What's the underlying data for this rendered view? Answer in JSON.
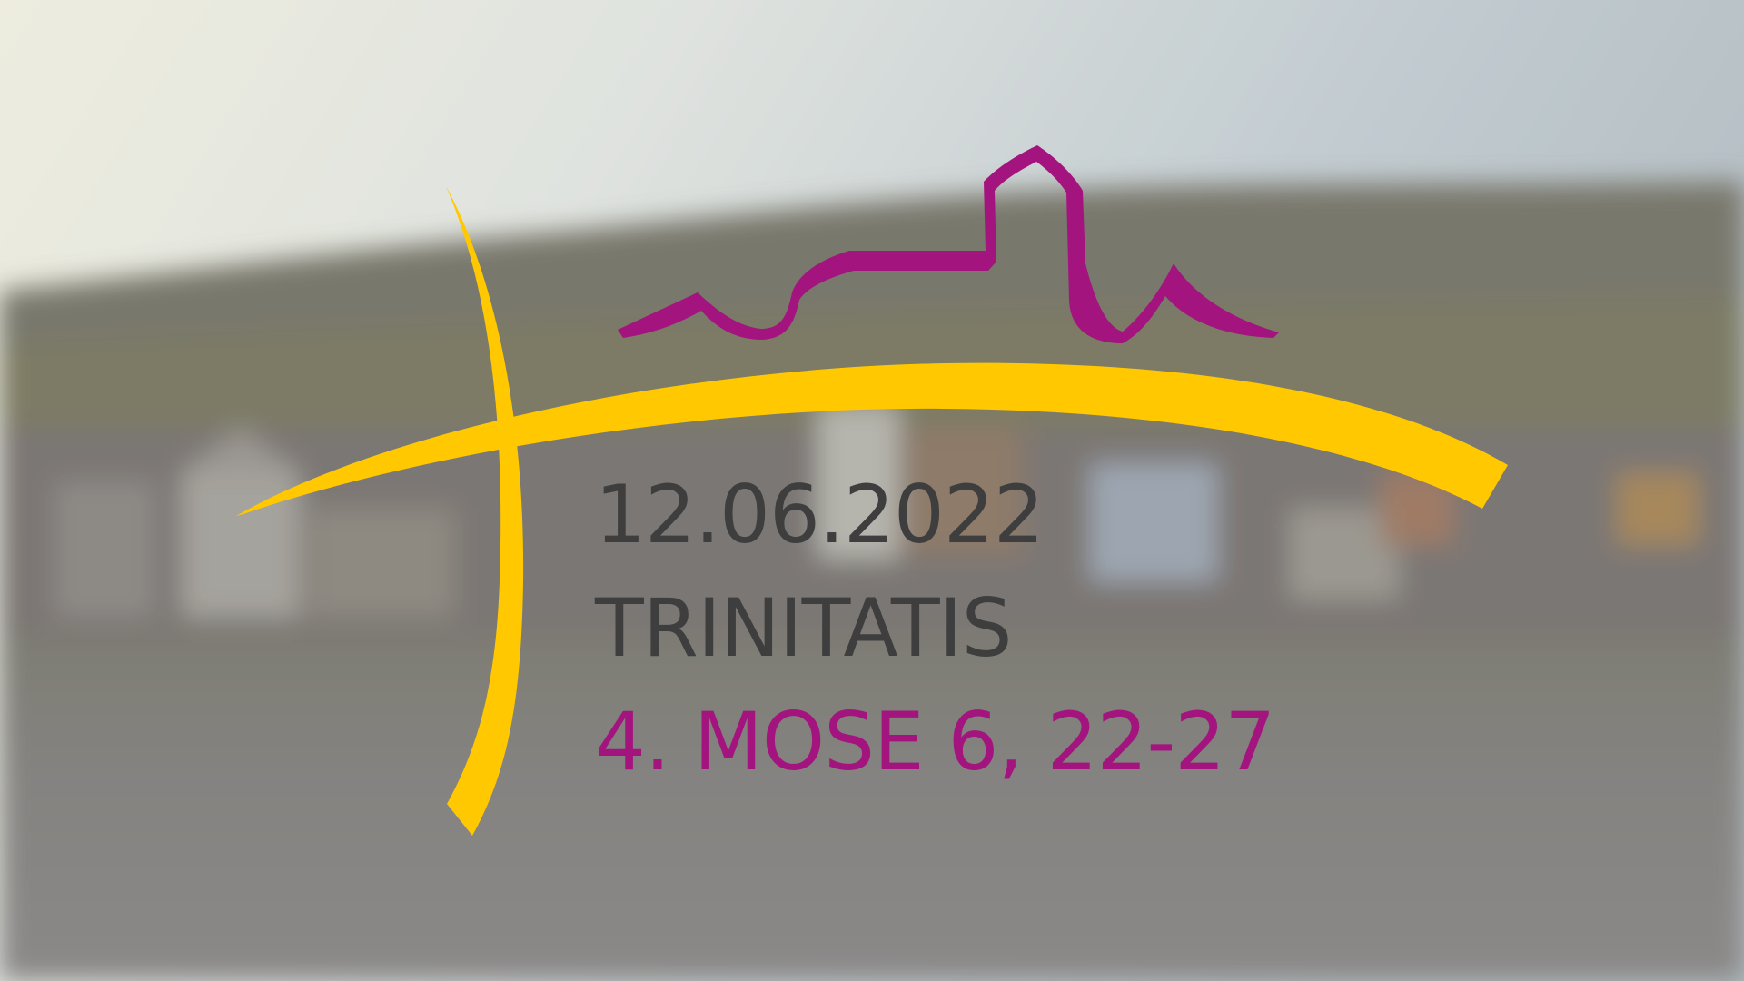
{
  "colors": {
    "cross": "#ffc800",
    "castle": "#a3147f",
    "text_dark": "#3e3e3e",
    "text_accent": "#a3147f"
  },
  "logo": {
    "icon": "cross-and-castle-logo-icon"
  },
  "content": {
    "date": "12.06.2022",
    "occasion": "TRINITATIS",
    "scripture": "4. MOSE 6, 22-27"
  }
}
